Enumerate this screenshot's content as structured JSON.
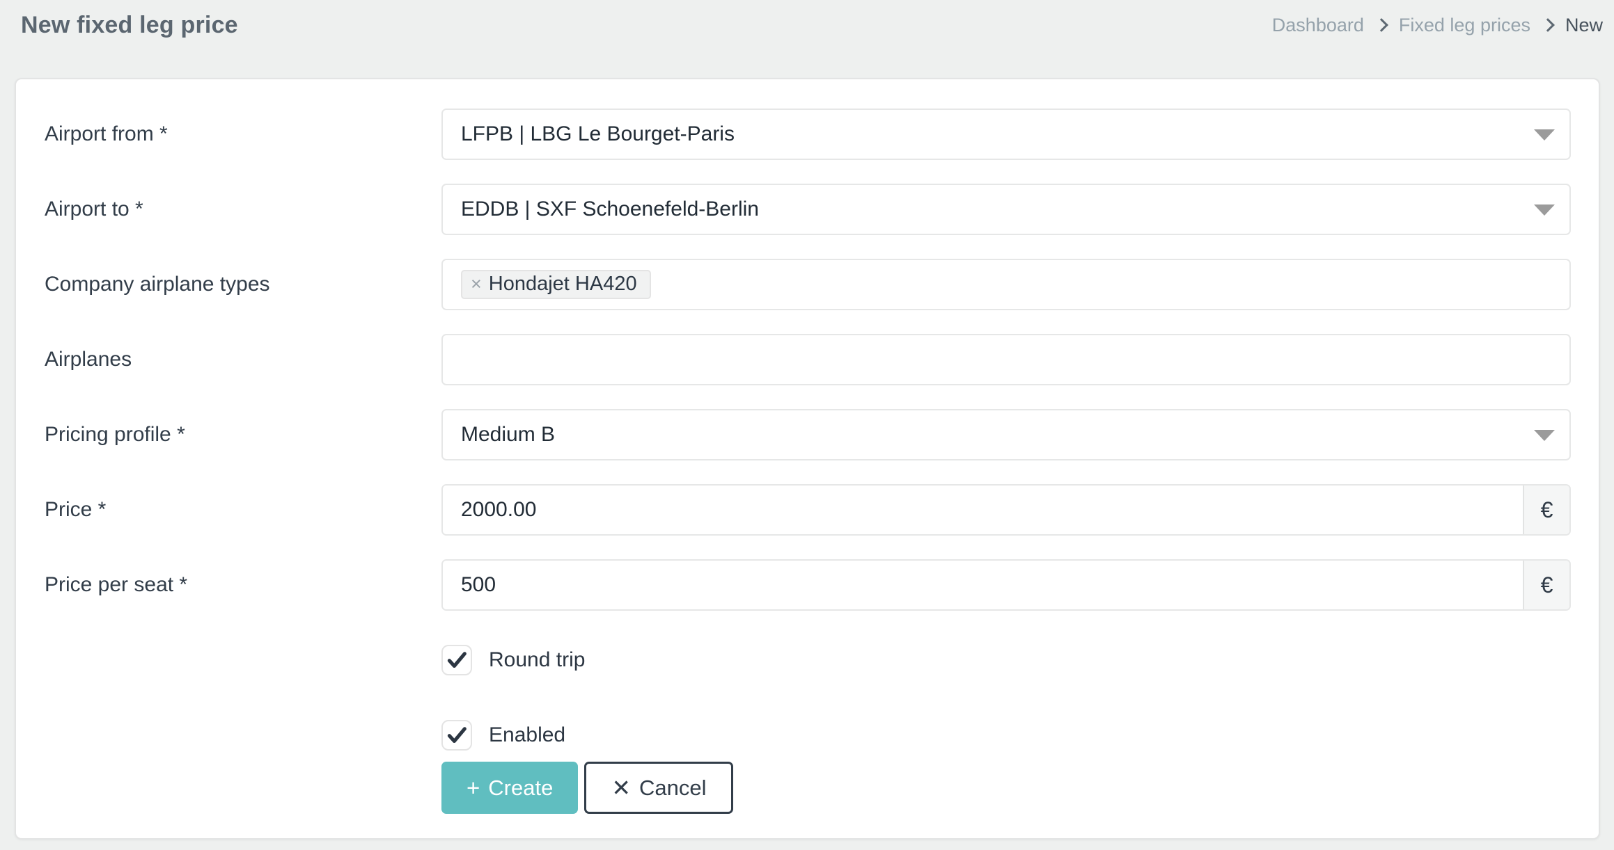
{
  "page": {
    "title": "New fixed leg price",
    "breadcrumb": {
      "items": [
        {
          "label": "Dashboard",
          "current": false
        },
        {
          "label": "Fixed leg prices",
          "current": false
        },
        {
          "label": "New",
          "current": true
        }
      ]
    }
  },
  "form": {
    "fields": [
      {
        "label": "Airport from *",
        "type": "select",
        "value": "LFPB | LBG Le Bourget-Paris"
      },
      {
        "label": "Airport to *",
        "type": "select",
        "value": "EDDB | SXF Schoenefeld-Berlin"
      },
      {
        "label": "Company airplane types",
        "type": "multiselect",
        "chips": [
          {
            "remove": "×",
            "label": "Hondajet HA420"
          }
        ]
      },
      {
        "label": "Airplanes",
        "type": "multiselect",
        "value": ""
      },
      {
        "label": "Pricing profile *",
        "type": "select",
        "value": "Medium B"
      },
      {
        "label": "Price *",
        "type": "number",
        "value": "2000.00",
        "addon": "€"
      },
      {
        "label": "Price per seat *",
        "type": "number",
        "value": "500",
        "addon": "€"
      }
    ],
    "checkboxes": [
      {
        "label": "Round trip",
        "checked": true
      },
      {
        "label": "Enabled",
        "checked": true
      }
    ],
    "buttons": {
      "create": {
        "icon": "+",
        "label": "Create"
      },
      "cancel": {
        "icon": "✕",
        "label": "Cancel"
      }
    }
  },
  "icons": {
    "breadcrumb_separator": "chevron-right",
    "select_caret": "triangle-down",
    "chip_remove": "x-remove",
    "checkbox_check": "checkmark"
  },
  "colors": {
    "page_background": "#eef0ef",
    "card_background": "#ffffff",
    "title_text": "#5b6670",
    "breadcrumb_link": "#95a2ab",
    "breadcrumb_current": "#47525c",
    "label_text": "#323d49",
    "field_border": "#e6e7e7",
    "accent_teal": "#60bec0",
    "cancel_border": "#323d49",
    "addon_background": "#f5f6f6",
    "chip_background": "#f1f2f2"
  }
}
